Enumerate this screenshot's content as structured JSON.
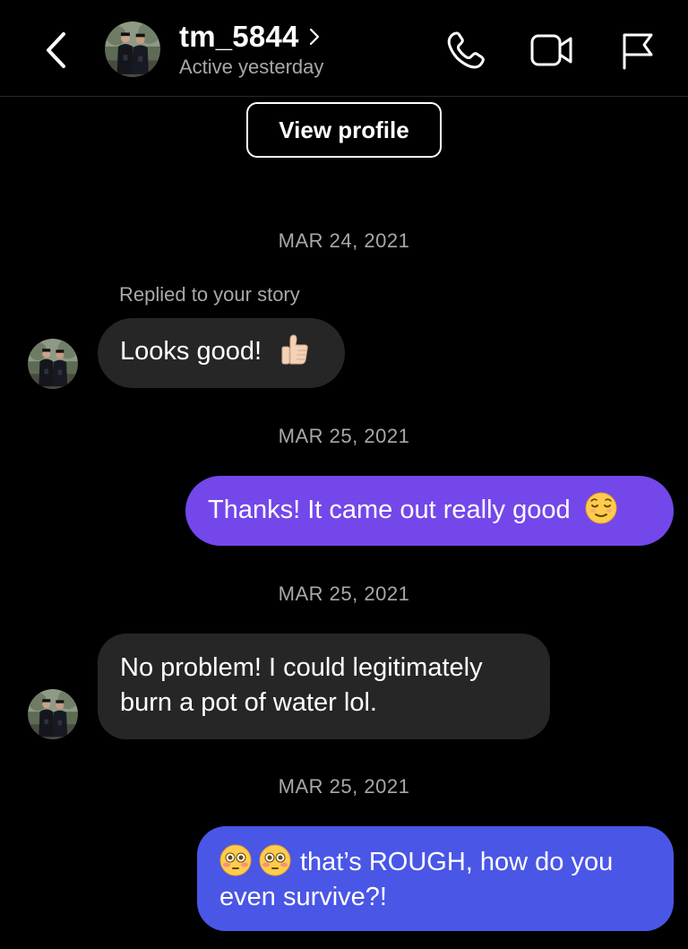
{
  "header": {
    "username": "tm_5844",
    "status": "Active yesterday"
  },
  "profile": {
    "view_profile_label": "View profile"
  },
  "messages": [
    {
      "date": "MAR 24, 2021",
      "context": "Replied to your story",
      "sender": "them",
      "text": "Looks good!",
      "emoji": "thumbs-up-icon"
    },
    {
      "date": "MAR 25, 2021",
      "sender": "me",
      "text": "Thanks! It came out really good",
      "emoji": "relieved-face-icon"
    },
    {
      "date": "MAR 25, 2021",
      "sender": "them",
      "lines": [
        "No problem! I could legitimately",
        "burn a pot of water lol."
      ]
    },
    {
      "date": "MAR 25, 2021",
      "sender": "me",
      "emoji_prefix": [
        "flushed-face-icon",
        "flushed-face-icon"
      ],
      "lines": [
        "that’s ROUGH, how do you",
        "even survive?!"
      ]
    }
  ],
  "colors": {
    "background": "#000000",
    "incoming_bubble": "#262626",
    "outgoing_bubble_1": "#7447ea",
    "outgoing_bubble_2": "#4a56e6",
    "secondary_text": "#a8a8a8"
  }
}
